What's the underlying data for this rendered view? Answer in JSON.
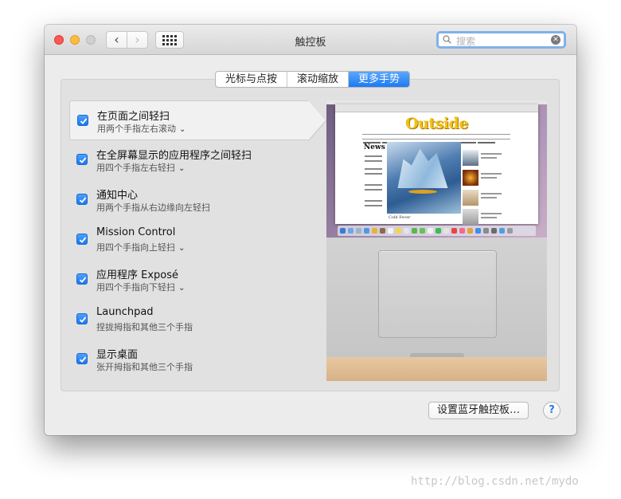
{
  "window": {
    "title": "触控板",
    "search_placeholder": "搜索",
    "nav": {
      "back_glyph": "‹",
      "forward_glyph": "›"
    },
    "icons": [
      "close-light",
      "minimize-light",
      "zoom-light",
      "chevron-left-icon",
      "chevron-right-icon",
      "grid-icon",
      "search-icon",
      "clear-search-icon"
    ]
  },
  "tabs": [
    {
      "label": "光标与点按",
      "active": false
    },
    {
      "label": "滚动缩放",
      "active": false
    },
    {
      "label": "更多手势",
      "active": true
    }
  ],
  "gestures": [
    {
      "title": "在页面之间轻扫",
      "subtitle": "用两个手指左右滚动",
      "checked": true,
      "has_menu": true,
      "selected": true
    },
    {
      "title": "在全屏幕显示的应用程序之间轻扫",
      "subtitle": "用四个手指左右轻扫",
      "checked": true,
      "has_menu": true,
      "selected": false
    },
    {
      "title": "通知中心",
      "subtitle": "用两个手指从右边缘向左轻扫",
      "checked": true,
      "has_menu": false,
      "selected": false
    },
    {
      "title": "Mission Control",
      "subtitle": "用四个手指向上轻扫",
      "checked": true,
      "has_menu": true,
      "selected": false
    },
    {
      "title": "应用程序 Exposé",
      "subtitle": "用四个手指向下轻扫",
      "checked": true,
      "has_menu": true,
      "selected": false
    },
    {
      "title": "Launchpad",
      "subtitle": "捏拢拇指和其他三个手指",
      "checked": true,
      "has_menu": false,
      "selected": false
    },
    {
      "title": "显示桌面",
      "subtitle": "张开拇指和其他三个手指",
      "checked": true,
      "has_menu": false,
      "selected": false
    }
  ],
  "preview": {
    "site_logo": "Outside",
    "news_heading": "News",
    "hero_caption": "Cold Fever"
  },
  "buttons": {
    "bluetooth": "设置蓝牙触控板…",
    "help": "?"
  },
  "watermark": "http://blog.csdn.net/mydo",
  "colors": {
    "accent": "#1c7bf3",
    "close": "#fc5753",
    "minimize": "#fdbc40",
    "search_focus": "#7fb1e9"
  }
}
